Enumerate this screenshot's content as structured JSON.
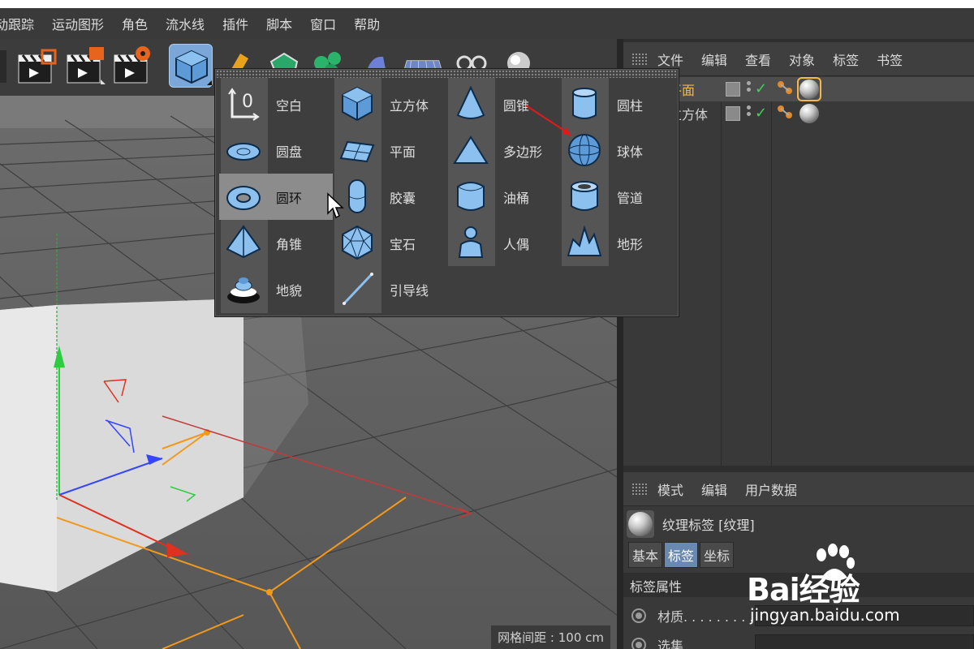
{
  "menubar": {
    "items": [
      "动跟踪",
      "运动图形",
      "角色",
      "流水线",
      "插件",
      "脚本",
      "窗口",
      "帮助"
    ]
  },
  "toolbar": {
    "buttons": [
      "render-view",
      "render-picture-viewer",
      "render-settings",
      "cube-primitives",
      "pen-spline",
      "subdivision-generators",
      "array-modeling",
      "deformer",
      "floor-environment",
      "camera",
      "light"
    ]
  },
  "primitives_menu": {
    "items": [
      {
        "label": "空白",
        "icon": "null-object-icon"
      },
      {
        "label": "圆盘",
        "icon": "disc-icon"
      },
      {
        "label": "圆环",
        "icon": "torus-icon"
      },
      {
        "label": "角锥",
        "icon": "pyramid-icon"
      },
      {
        "label": "地貌",
        "icon": "landscape-icon"
      },
      {
        "label": "立方体",
        "icon": "cube-icon"
      },
      {
        "label": "平面",
        "icon": "plane-icon"
      },
      {
        "label": "胶囊",
        "icon": "capsule-icon"
      },
      {
        "label": "宝石",
        "icon": "platonic-icon"
      },
      {
        "label": "引导线",
        "icon": "guide-line-icon"
      },
      {
        "label": "圆锥",
        "icon": "cone-icon"
      },
      {
        "label": "多边形",
        "icon": "polygon-icon"
      },
      {
        "label": "油桶",
        "icon": "oil-tank-icon"
      },
      {
        "label": "人偶",
        "icon": "figure-icon"
      },
      {
        "label": "圆柱",
        "icon": "cylinder-icon"
      },
      {
        "label": "球体",
        "icon": "sphere-icon"
      },
      {
        "label": "管道",
        "icon": "tube-icon"
      },
      {
        "label": "地形",
        "icon": "terrain-icon"
      }
    ],
    "hovered": "圆环"
  },
  "viewport": {
    "grid_spacing": "网格间距 : 100 cm"
  },
  "object_manager": {
    "menu": [
      "文件",
      "编辑",
      "查看",
      "对象",
      "标签",
      "书签"
    ],
    "objects": [
      {
        "name": "平面",
        "selected": true
      },
      {
        "name": "立方体",
        "selected": false
      }
    ]
  },
  "attribute_manager": {
    "menu": [
      "模式",
      "编辑",
      "用户数据"
    ],
    "tag_title": "纹理标签 [纹理]",
    "tabs": [
      "基本",
      "标签",
      "坐标"
    ],
    "active_tab": "标签",
    "section": "标签属性",
    "props": [
      {
        "label": "材质. . . . . . . . .",
        "value": ""
      },
      {
        "label": "选集",
        "value": ""
      }
    ]
  },
  "watermark": {
    "brand": "Bai经验",
    "url": "jingyan.baidu.com"
  },
  "colors": {
    "accent_blue": "#7aa7d8",
    "selected_object": "#f4b84a",
    "check_green": "#3fd35c",
    "arrow_red": "#e01a1a"
  }
}
